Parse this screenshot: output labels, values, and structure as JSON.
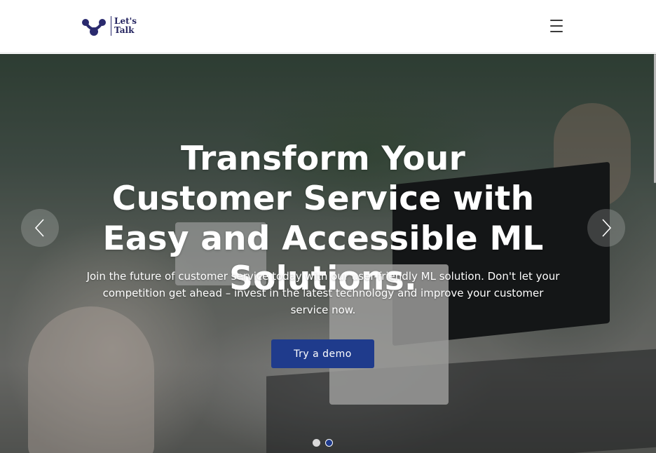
{
  "brand": {
    "logo_line1": "Let's",
    "logo_line2": "Talk",
    "logo_icon": "connected-nodes-logo",
    "color_primary": "#1f3b8c",
    "color_logo": "#2a2a6e"
  },
  "header": {
    "menu_icon": "hamburger-menu-icon"
  },
  "hero": {
    "headline": "Transform Your Customer Service with Easy and Accessible ML Solutions.",
    "subtext": "Join the future of customer service today with our user-friendly ML solution. Don't let your competition get ahead – invest in the latest technology and improve your customer service now.",
    "cta_label": "Try a demo",
    "prev_icon": "chevron-left-icon",
    "next_icon": "chevron-right-icon",
    "slides_total": 2,
    "active_slide": 2
  }
}
